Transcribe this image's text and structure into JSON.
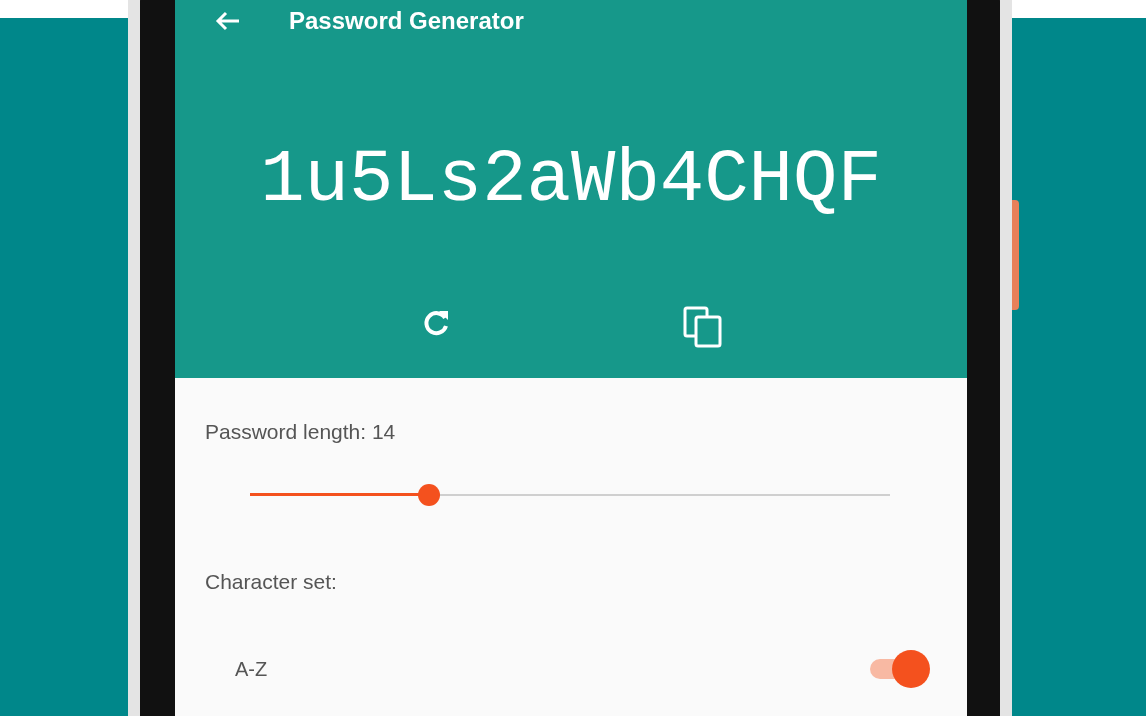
{
  "app_bar": {
    "title": "Password Generator"
  },
  "password": "1u5Ls2aWb4CHQF",
  "actions": [
    {
      "kind": "refresh"
    },
    {
      "kind": "copy"
    }
  ],
  "length": {
    "label": "Password length: 14",
    "level": 0.28
  },
  "character_set": {
    "label": "Character set:",
    "options": [
      {
        "label": "A-Z",
        "on": true
      }
    ]
  }
}
